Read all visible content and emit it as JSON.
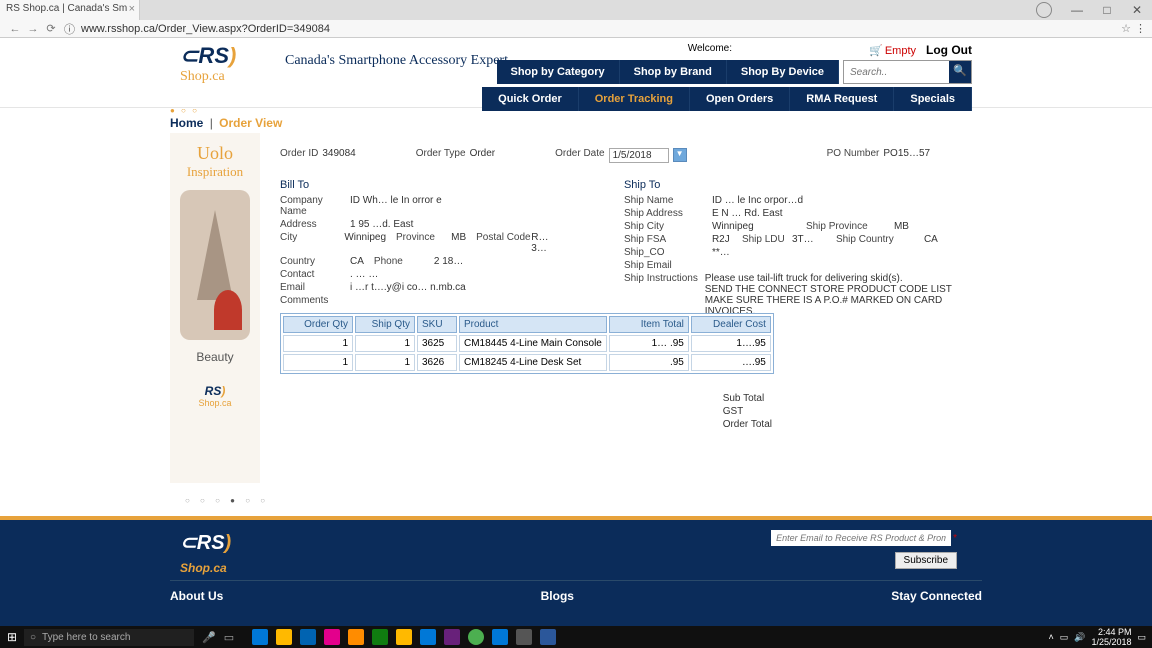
{
  "browser": {
    "tab_title": "RS Shop.ca | Canada's Sm",
    "url": "www.rsshop.ca/Order_View.aspx?OrderID=349084"
  },
  "header": {
    "tagline": "Canada's Smartphone Accessory Expert",
    "welcome": "Welcome:",
    "empty": "Empty",
    "logout": "Log Out",
    "nav1": {
      "a": "Shop by Category",
      "b": "Shop by Brand",
      "c": "Shop By Device"
    },
    "search_placeholder": "Search..",
    "nav2": {
      "a": "Quick Order",
      "b": "Order Tracking",
      "c": "Open Orders",
      "d": "RMA Request",
      "e": "Specials"
    }
  },
  "breadcrumb": {
    "home": "Home",
    "current": "Order View"
  },
  "ad": {
    "brand": "Uolo",
    "line": "Inspiration",
    "caption": "Beauty",
    "logo": "RS",
    "logo2": "Shop.ca"
  },
  "order": {
    "order_id_label": "Order ID",
    "order_id": "349084",
    "order_type_label": "Order Type",
    "order_type": "Order",
    "order_date_label": "Order Date",
    "order_date": "1/5/2018",
    "po_label": "PO Number",
    "po": "PO15…57",
    "bill_to": "Bill To",
    "company_label": "Company Name",
    "company": "ID Wh… le In orror e ",
    "address_label": "Address",
    "address": "1 95 …d. East",
    "city_label": "City",
    "city": "Winnipeg",
    "province_label": "Province",
    "province": "MB",
    "postal_label": "Postal Code",
    "postal": "R… 3…",
    "country_label": "Country",
    "country": "CA",
    "phone_label": "Phone",
    "phone": "2 18…",
    "contact_label": "Contact",
    "contact": ". …  …",
    "email_label": "Email",
    "email": "i …r t….y@i co… n.mb.ca",
    "comments_label": "Comments",
    "ship_to": "Ship To",
    "ship_name_label": "Ship Name",
    "ship_name": "ID … le Inc orpor…d",
    "ship_addr_label": "Ship Address",
    "ship_addr": "E N … Rd. East",
    "ship_city_label": "Ship City",
    "ship_city": "Winnipeg",
    "ship_prov_label": "Ship Province",
    "ship_prov": "MB",
    "ship_fsa_label": "Ship FSA",
    "ship_fsa": "R2J",
    "ship_ldu_label": "Ship LDU",
    "ship_ldu": "3T…",
    "ship_country_label": "Ship Country",
    "ship_country": "CA",
    "ship_co_label": "Ship_CO",
    "ship_co": "**…",
    "ship_email_label": "Ship Email",
    "ship_inst_label": "Ship Instructions",
    "ship_inst": "Please use tail-lift truck for delivering skid(s).\nSEND THE CONNECT STORE PRODUCT CODE LIST\nMAKE SURE THERE IS A P.O.# MARKED ON CARD INVOICES."
  },
  "table": {
    "h_oqty": "Order Qty",
    "h_sqty": "Ship Qty",
    "h_sku": "SKU",
    "h_prod": "Product",
    "h_itot": "Item Total",
    "h_dcost": "Dealer Cost",
    "rows": [
      {
        "oqty": "1",
        "sqty": "1",
        "sku": "3625",
        "prod": "CM18445 4-Line Main Console",
        "itot": "1… .95",
        "dcost": "1….95"
      },
      {
        "oqty": "1",
        "sqty": "1",
        "sku": "3626",
        "prod": "CM18245 4-Line Desk Set",
        "itot": ".95",
        "dcost": "….95"
      }
    ]
  },
  "totals": {
    "sub": "Sub Total",
    "gst": "GST",
    "ord": "Order Total"
  },
  "footer": {
    "email_placeholder": "Enter Email to Receive RS Product & Promo Updates",
    "subscribe": "Subscribe",
    "about": "About Us",
    "blogs": "Blogs",
    "stay": "Stay Connected"
  },
  "taskbar": {
    "search": "Type here to search",
    "time": "2:44 PM",
    "date": "1/25/2018"
  }
}
